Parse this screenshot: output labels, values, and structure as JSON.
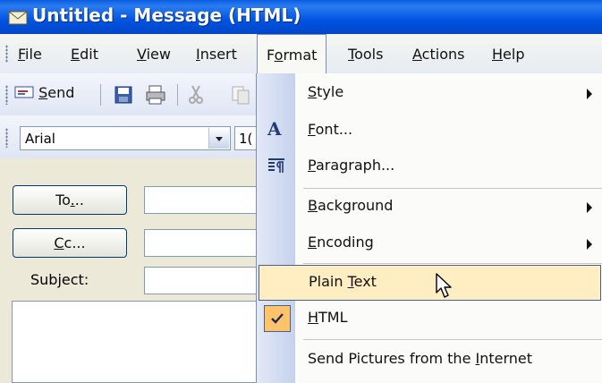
{
  "window": {
    "title": "Untitled - Message (HTML)"
  },
  "menubar": {
    "items": [
      {
        "pre": "",
        "u": "F",
        "post": "ile"
      },
      {
        "pre": "",
        "u": "E",
        "post": "dit"
      },
      {
        "pre": "",
        "u": "V",
        "post": "iew"
      },
      {
        "pre": "",
        "u": "I",
        "post": "nsert"
      },
      {
        "pre": "F",
        "u": "o",
        "post": "rmat"
      },
      {
        "pre": "",
        "u": "T",
        "post": "ools"
      },
      {
        "pre": "",
        "u": "A",
        "post": "ctions"
      },
      {
        "pre": "",
        "u": "H",
        "post": "elp"
      }
    ]
  },
  "toolbar": {
    "send": {
      "pre": "",
      "u": "S",
      "post": "end"
    }
  },
  "format_bar": {
    "font": "Arial",
    "size": "1("
  },
  "form": {
    "to": {
      "pre": "To",
      "u": ".",
      "post": ".."
    },
    "cc": {
      "pre": "",
      "u": "C",
      "post": "c..."
    },
    "subject_label": "Subject:"
  },
  "format_menu": {
    "items": [
      {
        "pre": "",
        "u": "S",
        "post": "tyle"
      },
      {
        "pre": "",
        "u": "F",
        "post": "ont..."
      },
      {
        "pre": "",
        "u": "P",
        "post": "aragraph..."
      },
      {
        "pre": "",
        "u": "B",
        "post": "ackground"
      },
      {
        "pre": "",
        "u": "E",
        "post": "ncoding"
      },
      {
        "pre": "Plain ",
        "u": "T",
        "post": "ext"
      },
      {
        "pre": "",
        "u": "H",
        "post": "TML"
      },
      {
        "pre": "Send Pictures from the ",
        "u": "I",
        "post": "nternet"
      }
    ],
    "font_icon_glyph": "A",
    "highlight_color": "#ffeec2",
    "check_color": "#ffc46b"
  }
}
